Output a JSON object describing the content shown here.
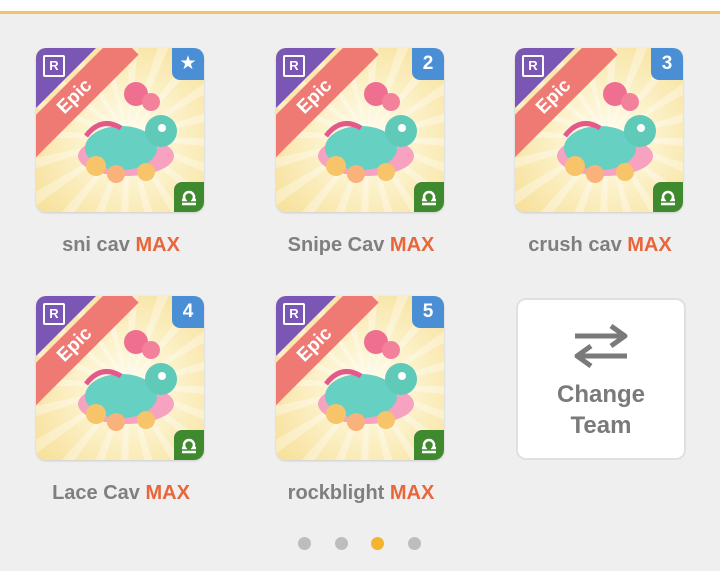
{
  "team_slots": [
    {
      "badge": "★",
      "badge_icon": "star-icon",
      "rarity": "Epic",
      "name": "sni cav",
      "level": "MAX"
    },
    {
      "badge": "2",
      "rarity": "Epic",
      "name": "Snipe Cav",
      "level": "MAX"
    },
    {
      "badge": "3",
      "rarity": "Epic",
      "name": "crush cav",
      "level": "MAX"
    },
    {
      "badge": "4",
      "rarity": "Epic",
      "name": "Lace Cav",
      "level": "MAX"
    },
    {
      "badge": "5",
      "rarity": "Epic",
      "name": "rockblight",
      "level": "MAX"
    }
  ],
  "card": {
    "r_label": "R",
    "element_icon": "libra-icon"
  },
  "change_team": {
    "icon": "swap-arrows-icon",
    "line1": "Change",
    "line2": "Team"
  },
  "pagination": {
    "total": 4,
    "active_index": 2
  },
  "colors": {
    "accent_orange": "#e8663a",
    "rarity_band": "#ef7a73",
    "team_badge": "#4a8fd6",
    "element_badge": "#3f8a2e",
    "active_dot": "#f2b431"
  }
}
